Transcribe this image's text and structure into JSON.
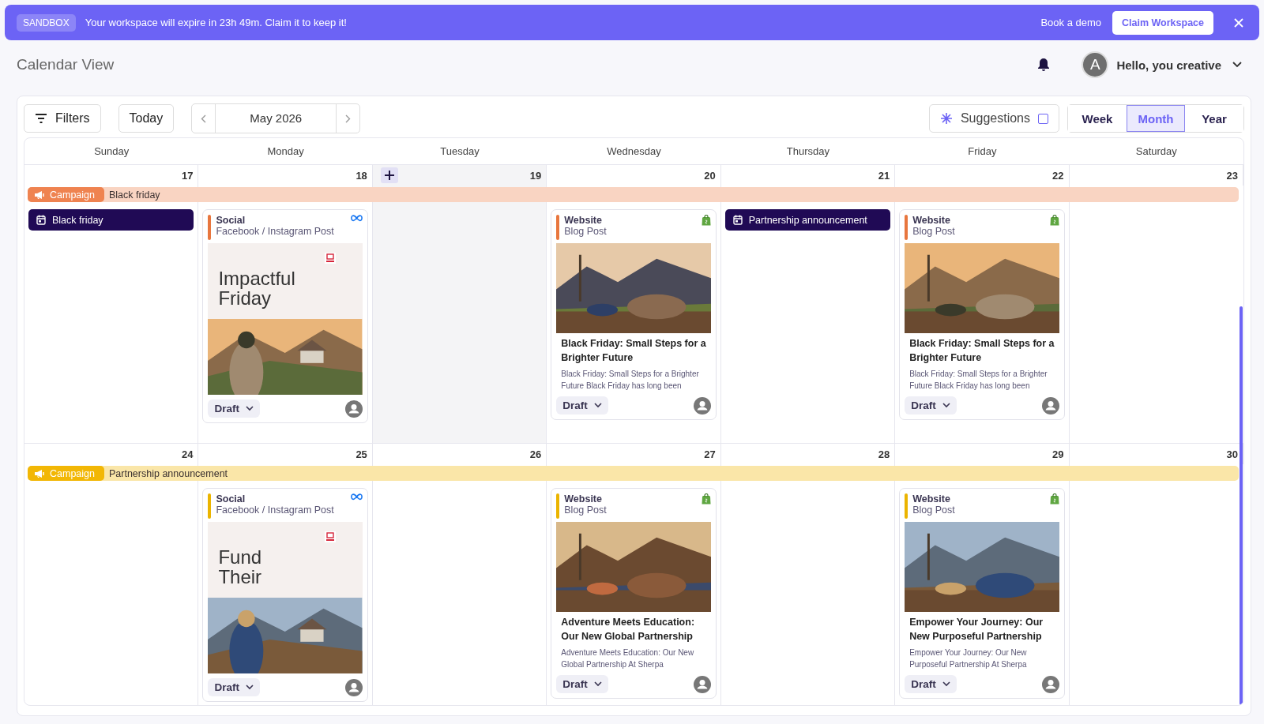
{
  "banner": {
    "badge": "SANDBOX",
    "message": "Your workspace will expire in 23h 49m. Claim it to keep it!",
    "link": "Book a demo",
    "button": "Claim Workspace"
  },
  "header": {
    "title": "Calendar View",
    "avatar": "A",
    "greeting": "Hello, you creative"
  },
  "toolbar": {
    "filters": "Filters",
    "today": "Today",
    "period": "May 2026",
    "suggestions": {
      "label": "Suggestions",
      "checked": false
    },
    "views": [
      {
        "label": "Week",
        "selected": false
      },
      {
        "label": "Month",
        "selected": true
      },
      {
        "label": "Year",
        "selected": false
      }
    ]
  },
  "weekdays": [
    "Sunday",
    "Monday",
    "Tuesday",
    "Wednesday",
    "Thursday",
    "Friday",
    "Saturday"
  ],
  "weeks": [
    {
      "campaign": {
        "badge": "Campaign",
        "name": "Black friday",
        "color": "#ef8350"
      },
      "days": [
        {
          "date": "17",
          "hovered": false,
          "items": [
            {
              "kind": "event",
              "label": "Black friday"
            }
          ]
        },
        {
          "date": "18",
          "hovered": false,
          "items": [
            {
              "kind": "post",
              "channel": "Social",
              "format": "Facebook / Instagram Post",
              "platform": {
                "kind": "meta"
              },
              "color": "#e8763e",
              "preview": {
                "kind": "creative",
                "headline": [
                  "Impactful",
                  "Friday"
                ]
              },
              "status": "Draft"
            }
          ]
        },
        {
          "date": "19",
          "hovered": true
        },
        {
          "date": "20",
          "hovered": false,
          "items": [
            {
              "kind": "post",
              "channel": "Website",
              "format": "Blog Post",
              "platform": {
                "kind": "shop"
              },
              "color": "#e8763e",
              "title": "Black Friday: Small Steps for a Brighter Future",
              "excerpt": "Black Friday: Small Steps for a Brighter Future Black Friday has long been",
              "status": "Draft"
            }
          ]
        },
        {
          "date": "21",
          "hovered": false,
          "items": [
            {
              "kind": "event",
              "label": "Partnership announcement"
            }
          ]
        },
        {
          "date": "22",
          "hovered": false,
          "items": [
            {
              "kind": "post",
              "channel": "Website",
              "format": "Blog Post",
              "platform": {
                "kind": "shop"
              },
              "color": "#e8763e",
              "title": "Black Friday: Small Steps for a Brighter Future",
              "excerpt": "Black Friday: Small Steps for a Brighter Future Black Friday has long been",
              "status": "Draft"
            }
          ]
        },
        {
          "date": "23",
          "hovered": false
        }
      ]
    },
    {
      "campaign": {
        "badge": "Campaign",
        "name": "Partnership announcement",
        "color": "#f2b705"
      },
      "days": [
        {
          "date": "24",
          "hovered": false
        },
        {
          "date": "25",
          "hovered": false,
          "items": [
            {
              "kind": "post",
              "channel": "Social",
              "format": "Facebook / Instagram Post",
              "platform": {
                "kind": "meta"
              },
              "color": "#ebb400",
              "preview": {
                "kind": "creative",
                "headline": [
                  "Fund",
                  "Their"
                ]
              },
              "status": "Draft"
            }
          ]
        },
        {
          "date": "26",
          "hovered": false
        },
        {
          "date": "27",
          "hovered": false,
          "items": [
            {
              "kind": "post",
              "channel": "Website",
              "format": "Blog Post",
              "platform": {
                "kind": "shop"
              },
              "color": "#ebb400",
              "title": "Adventure Meets Education: Our New Global Partnership",
              "excerpt": "Adventure Meets Education: Our New Global Partnership At Sherpa",
              "status": "Draft"
            }
          ]
        },
        {
          "date": "28",
          "hovered": false
        },
        {
          "date": "29",
          "hovered": false,
          "items": [
            {
              "kind": "post",
              "channel": "Website",
              "format": "Blog Post",
              "platform": {
                "kind": "shop"
              },
              "color": "#ebb400",
              "title": "Empower Your Journey: Our New Purposeful Partnership",
              "excerpt": "Empower Your Journey: Our New Purposeful Partnership At Sherpa",
              "status": "Draft"
            }
          ]
        },
        {
          "date": "30",
          "hovered": false
        }
      ]
    }
  ]
}
